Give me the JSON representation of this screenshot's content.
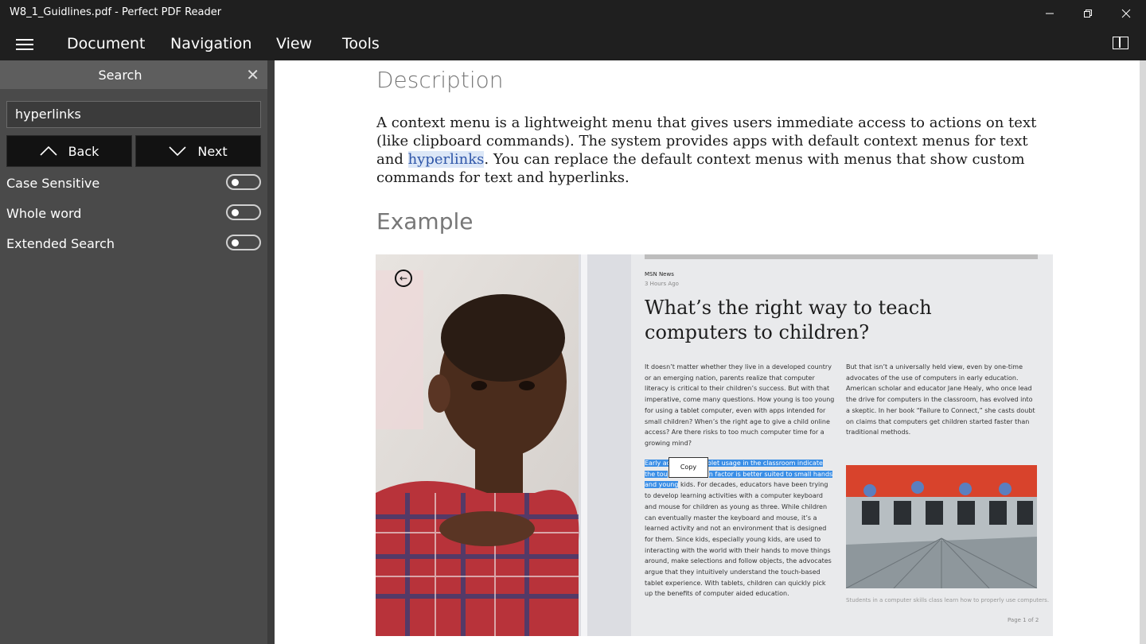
{
  "window": {
    "title": "W8_1_Guidlines.pdf - Perfect PDF Reader"
  },
  "menu": {
    "items": [
      "Document",
      "Navigation",
      "View",
      "Tools"
    ]
  },
  "search_panel": {
    "title": "Search",
    "query": "hyperlinks",
    "back_label": "Back",
    "next_label": "Next",
    "options": [
      {
        "label": "Case Sensitive",
        "on": false
      },
      {
        "label": "Whole word",
        "on": false
      },
      {
        "label": "Extended Search",
        "on": false
      }
    ]
  },
  "document": {
    "heading_description": "Description",
    "para_part1": "A context menu is a lightweight menu that gives users immediate access to actions on text (like clipboard commands). The system provides apps with default context menus for text and ",
    "para_highlight": "hyperlinks",
    "para_part2": ". You can replace the default context menus with menus that show custom commands for text and hyperlinks.",
    "heading_example": "Example",
    "figure": {
      "source": "MSN News",
      "time": "3 Hours Ago",
      "headline": "What’s the right way to teach computers to children?",
      "col1_para1": "It doesn’t matter whether they live in a developed country or an emerging nation, parents realize that computer literacy is critical to their children’s success. But with that imperative, come many questions. How young is too young for using a tablet computer, even with apps intended for small children? When’s the right age to give a child online access? Are there risks to too much computer time for a growing mind?",
      "col1_sel_a": "Early ad",
      "col1_sel_b": "blet usage in the classroom indicate",
      "col1_sel_c": "the tou",
      "col1_sel_d": "n factor is better suited to small hands",
      "col1_sel_e": "and young",
      "col1_rest": " kids. For decades, educators have been trying to develop learning activities with a computer keyboard and mouse for children as young as three. While children can eventually master the keyboard and mouse, it’s a learned activity and not an environment that is designed for them. Since kids, especially young kids, are used to interacting with the world with their hands to move things around, make selections and follow objects, the advocates argue that they intuitively understand the touch-based tablet experience. With tablets, children can quickly pick up the benefits of computer aided education.",
      "col2_para": "But that isn’t a universally held view, even by one-time advocates of the use of computers in early education. American scholar and educator Jane Healy, who once lead the drive for computers in the classroom, has evolved into a skeptic. In her book “Failure to Connect,” she casts doubt on claims that computers get children started faster than traditional methods.",
      "copy_label": "Copy",
      "caption": "Students in a computer skills class learn how to properly use computers.",
      "page": "Page 1 of 2"
    }
  }
}
